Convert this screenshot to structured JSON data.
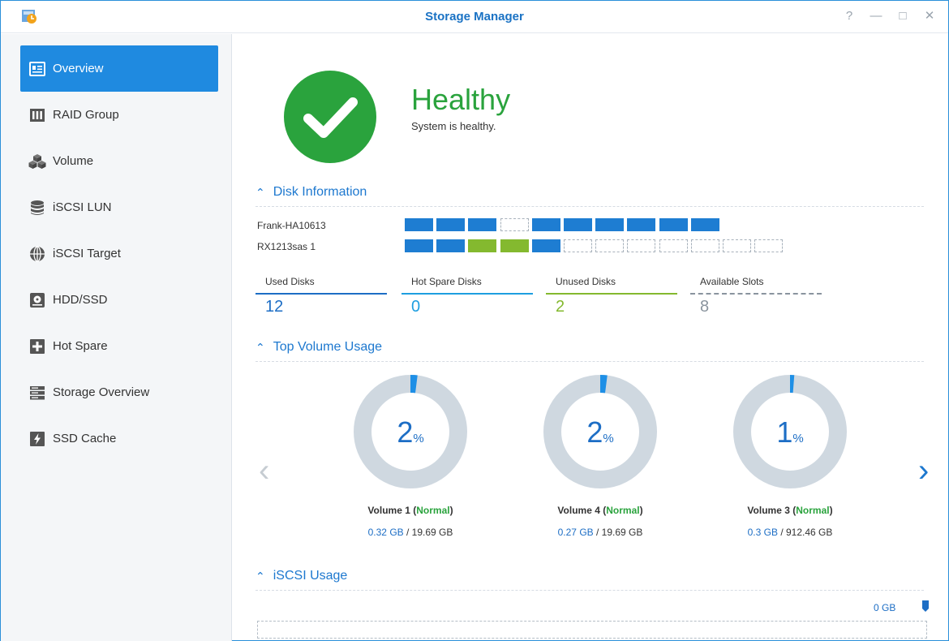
{
  "window": {
    "title": "Storage Manager"
  },
  "controls": {
    "help": "?",
    "minimize": "—",
    "maximize": "□",
    "close": "✕"
  },
  "sidebar": {
    "items": [
      {
        "label": "Overview",
        "icon": "overview-icon",
        "active": true
      },
      {
        "label": "RAID Group",
        "icon": "raid-group-icon"
      },
      {
        "label": "Volume",
        "icon": "volume-icon"
      },
      {
        "label": "iSCSI LUN",
        "icon": "iscsi-lun-icon"
      },
      {
        "label": "iSCSI Target",
        "icon": "iscsi-target-icon"
      },
      {
        "label": "HDD/SSD",
        "icon": "hdd-ssd-icon"
      },
      {
        "label": "Hot Spare",
        "icon": "hot-spare-icon"
      },
      {
        "label": "Storage Overview",
        "icon": "storage-overview-icon"
      },
      {
        "label": "SSD Cache",
        "icon": "ssd-cache-icon"
      }
    ]
  },
  "health": {
    "status": "Healthy",
    "message": "System is healthy.",
    "color": "#2aa33d"
  },
  "disk_info": {
    "heading": "Disk Information",
    "devices": [
      {
        "name": "Frank-HA10613",
        "slots": [
          "used",
          "used",
          "used",
          "empty",
          "used",
          "used",
          "used",
          "used",
          "used",
          "used"
        ]
      },
      {
        "name": "RX1213sas 1",
        "slots": [
          "used",
          "used",
          "spare",
          "spare",
          "used",
          "empty",
          "empty",
          "empty",
          "empty",
          "empty",
          "empty",
          "empty"
        ]
      }
    ],
    "stats": [
      {
        "label": "Used Disks",
        "value": "12",
        "color": "#1d6ec5"
      },
      {
        "label": "Hot Spare Disks",
        "value": "0",
        "color": "#1e9ee0"
      },
      {
        "label": "Unused Disks",
        "value": "2",
        "color": "#84b92f"
      },
      {
        "label": "Available Slots",
        "value": "8",
        "color": "#8a949e"
      }
    ]
  },
  "volume_usage": {
    "heading": "Top Volume Usage",
    "volumes": [
      {
        "percent": "2",
        "unit": "%",
        "name": "Volume 1",
        "status": "Normal",
        "used": "0.32 GB",
        "total": " / 19.69 GB",
        "fraction": 0.02
      },
      {
        "percent": "2",
        "unit": "%",
        "name": "Volume 4",
        "status": "Normal",
        "used": "0.27 GB",
        "total": " / 19.69 GB",
        "fraction": 0.02
      },
      {
        "percent": "1",
        "unit": "%",
        "name": "Volume 3",
        "status": "Normal",
        "used": "0.3 GB",
        "total": " / 912.46 GB",
        "fraction": 0.01
      }
    ],
    "prev": "‹",
    "next": "›"
  },
  "iscsi_usage": {
    "heading": "iSCSI Usage",
    "value": "0 GB"
  },
  "colors": {
    "accent": "#1f8ae0",
    "healthy": "#2aa33d",
    "ring": "#cfd8e0"
  }
}
